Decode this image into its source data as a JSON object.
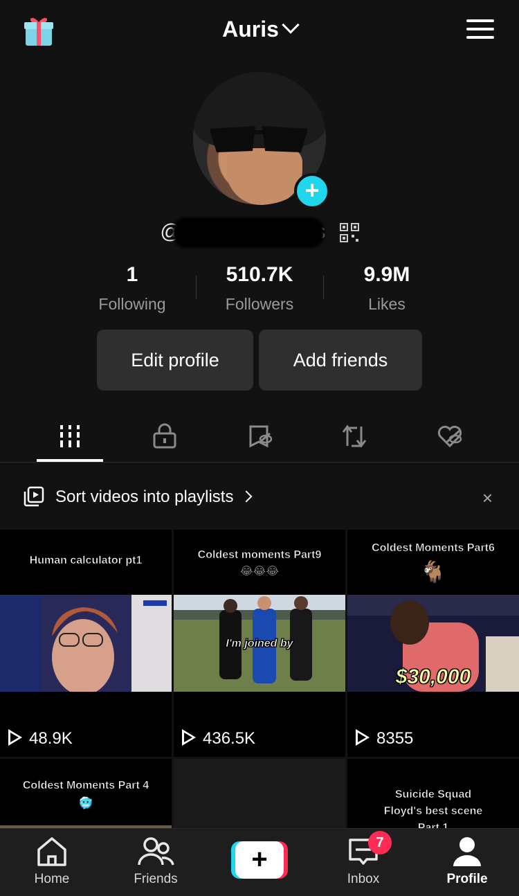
{
  "header": {
    "gift_icon": "gift-icon",
    "title": "Auris",
    "menu_icon": "hamburger-menu-icon"
  },
  "profile": {
    "username_visible_start": "@g",
    "username_visible_end": "as",
    "stats": [
      {
        "value": "1",
        "label": "Following"
      },
      {
        "value": "510.7K",
        "label": "Followers"
      },
      {
        "value": "9.9M",
        "label": "Likes"
      }
    ],
    "edit_profile": "Edit profile",
    "add_friends": "Add friends"
  },
  "tabs": [
    "videos-grid-icon",
    "private-lock-icon",
    "favorites-hidden-icon",
    "reposts-icon",
    "liked-hidden-icon"
  ],
  "playlist_banner": {
    "text": "Sort videos into playlists",
    "close": "×"
  },
  "videos": [
    {
      "caption": "Human calculator pt1",
      "plays": "48.9K",
      "overlay": ""
    },
    {
      "caption": "Coldest moments Part9",
      "emoji": "😂😂😂",
      "plays": "436.5K",
      "overlay": "I'm joined by"
    },
    {
      "caption": "Coldest Moments Part6",
      "emoji": "🐐",
      "plays": "8355",
      "overlay": "$30,000"
    },
    {
      "caption": "Coldest  Moments Part 4",
      "emoji": "🥶",
      "plays": "",
      "overlay": ""
    },
    {
      "caption": "",
      "plays": "",
      "overlay": ""
    },
    {
      "caption": "Suicide Squad\nFloyd's best scene\nPart 1",
      "plays": "",
      "overlay": ""
    }
  ],
  "bottom_nav": {
    "home": "Home",
    "friends": "Friends",
    "create": "+",
    "inbox": "Inbox",
    "inbox_badge": "7",
    "profile": "Profile"
  },
  "colors": {
    "background": "#121212",
    "button_bg": "#2f2f2f",
    "accent_cyan": "#20d5ec",
    "accent_red": "#fe2c55"
  }
}
